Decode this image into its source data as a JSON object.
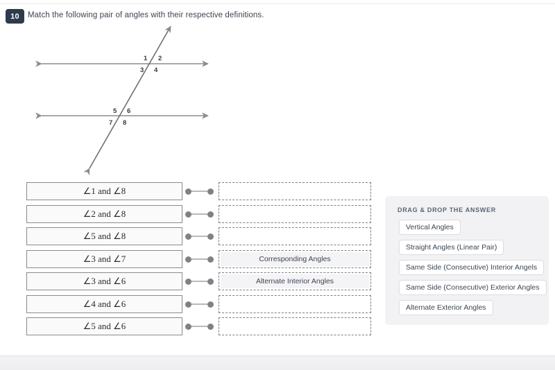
{
  "question": {
    "number": "10",
    "prompt": "Match the following pair of angles with their respective definitions."
  },
  "figure": {
    "description": "two parallel horizontal lines cut by a transversal",
    "angle_labels": [
      "1",
      "2",
      "3",
      "4",
      "5",
      "6",
      "7",
      "8"
    ],
    "upper_intersection": {
      "top_left": "1",
      "top_right": "2",
      "bottom_left": "3",
      "bottom_right": "4"
    },
    "lower_intersection": {
      "top_left": "5",
      "top_right": "6",
      "bottom_left": "7",
      "bottom_right": "8"
    },
    "line_color": "#8c8c8c"
  },
  "match_rows": [
    {
      "prompt": "∠1 and ∠8",
      "answer": ""
    },
    {
      "prompt": "∠2 and ∠8",
      "answer": ""
    },
    {
      "prompt": "∠5 and ∠8",
      "answer": ""
    },
    {
      "prompt": "∠3 and ∠7",
      "answer": "Corresponding Angles"
    },
    {
      "prompt": "∠3 and  ∠6",
      "answer": "Alternate Interior Angles"
    },
    {
      "prompt": "∠4 and ∠6",
      "answer": ""
    },
    {
      "prompt": "∠5 and ∠6",
      "answer": ""
    }
  ],
  "drag_drop": {
    "title": "DRAG & DROP THE ANSWER",
    "options": [
      "Vertical Angles",
      "Straight Angles (Linear Pair)",
      "Same Side (Consecutive) Interior Angels",
      "Same Side (Consecutive) Exterior Angles",
      "Alternate Exterior Angles"
    ]
  },
  "colors": {
    "badge": "#2e3a4d",
    "panel_bg": "#f2f2f4",
    "connector_dot": "#808186",
    "box_border": "#8a8a8a"
  }
}
